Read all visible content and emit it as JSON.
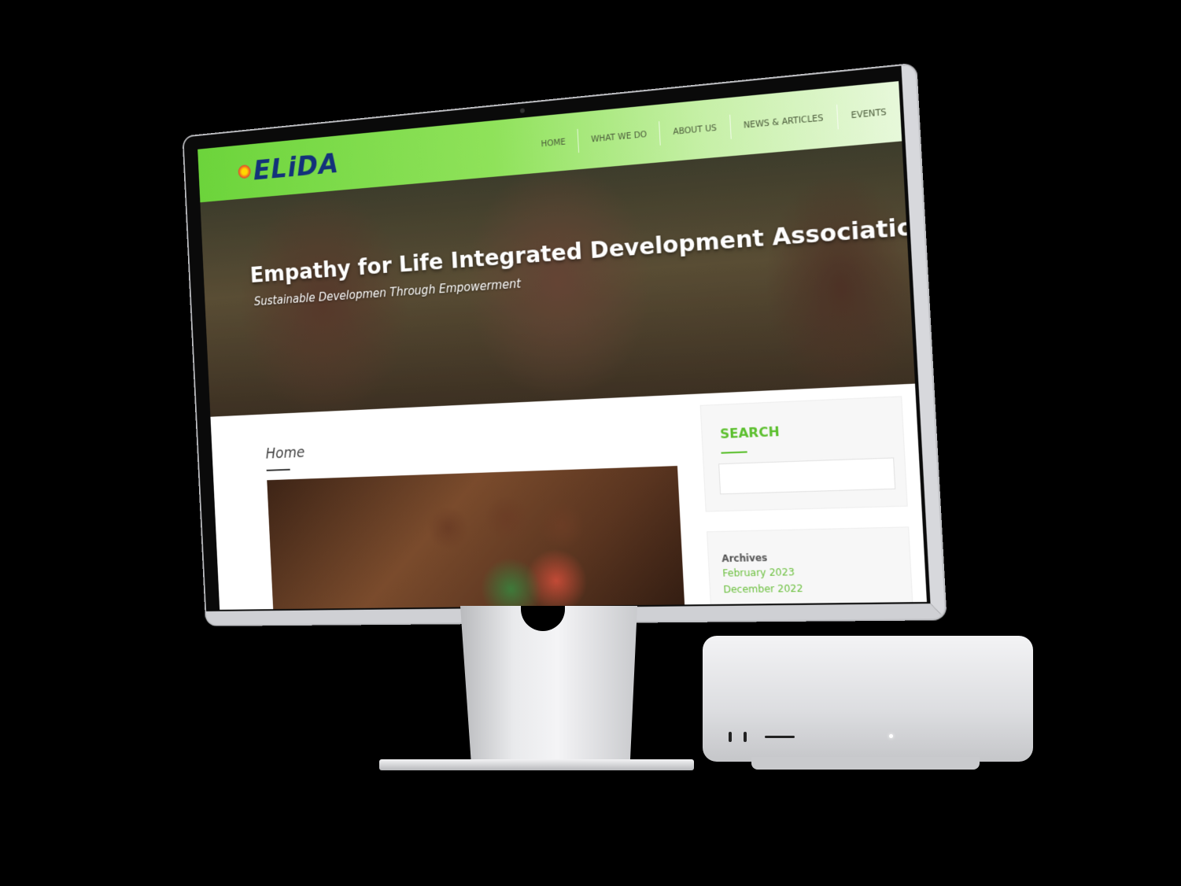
{
  "site": {
    "logo_text": "ELiDA",
    "nav": [
      {
        "label": "HOME"
      },
      {
        "label": "WHAT WE DO"
      },
      {
        "label": "ABOUT US"
      },
      {
        "label": "NEWS & ARTICLES"
      },
      {
        "label": "EVENTS"
      }
    ],
    "hero": {
      "title": "Empathy for Life Integrated Development Association",
      "subtitle": "Sustainable Developmen Through Empowerment"
    },
    "page": {
      "heading": "Home"
    },
    "sidebar": {
      "search_title": "SEARCH",
      "search_placeholder": "",
      "archives_title": "Archives",
      "archives": [
        "February 2023",
        "December 2022"
      ]
    }
  },
  "colors": {
    "header_green": "#6cd43b",
    "accent_green": "#5bbf2d",
    "logo_navy": "#13327a"
  }
}
